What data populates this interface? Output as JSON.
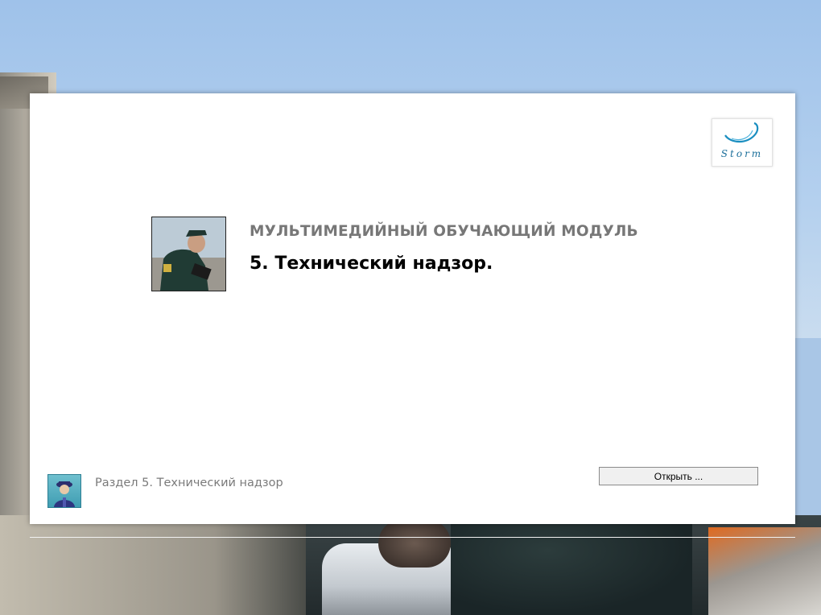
{
  "module": {
    "subtitle": "МУЛЬТИМЕДИЙНЫЙ ОБУЧАЮЩИЙ МОДУЛЬ",
    "title": "5. Технический надзор."
  },
  "logo": {
    "text": "Storm",
    "icon": "storm-wave-logo-icon",
    "color": "#1a6e9a"
  },
  "section": {
    "label": "Раздел 5. Технический надзор",
    "icon": "officer-avatar-icon"
  },
  "actions": {
    "open_label": "Открыть ..."
  },
  "colors": {
    "subtitle": "#777777",
    "title": "#000000",
    "section_label": "#7a7a7a",
    "panel": "#ffffff"
  }
}
